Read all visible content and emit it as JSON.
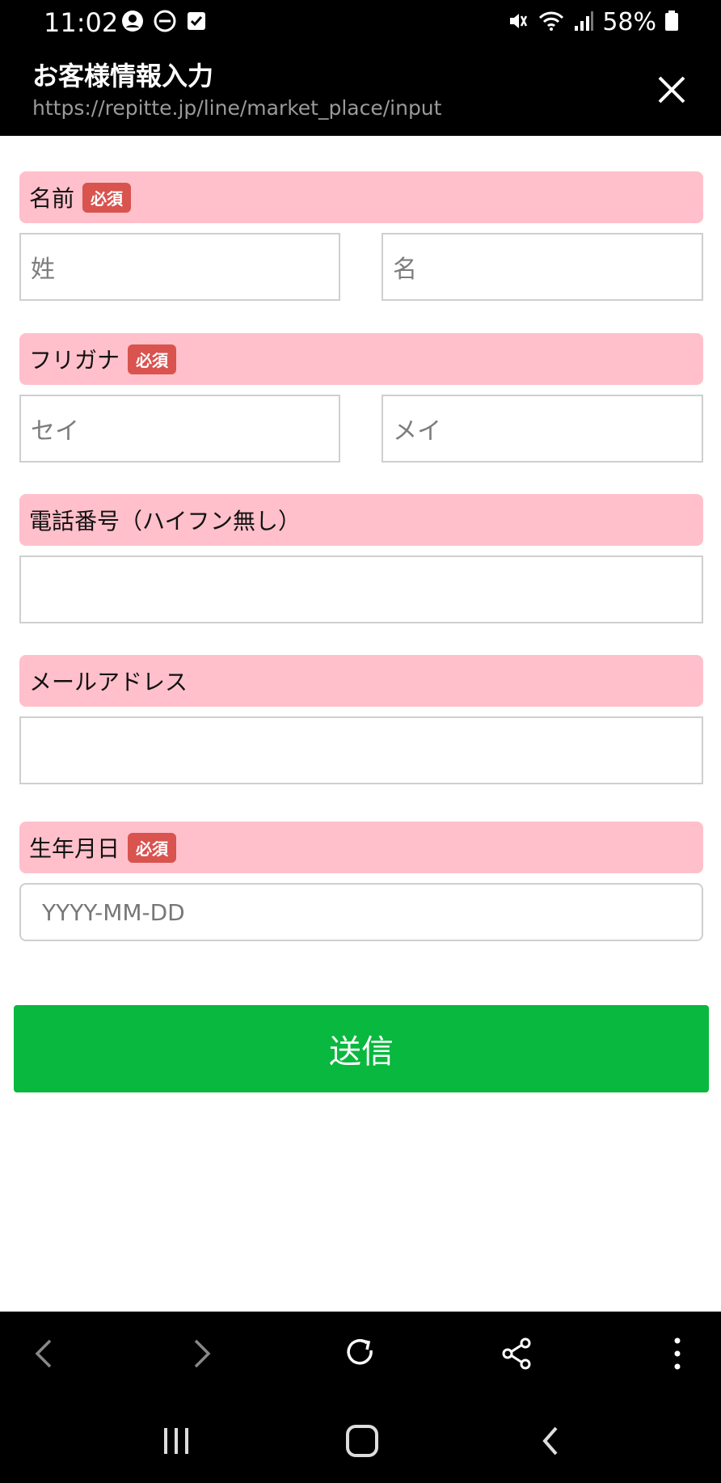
{
  "status_bar": {
    "time": "11:02",
    "battery_percent": "58%"
  },
  "app_bar": {
    "title": "お客様情報入力",
    "url": "https://repitte.jp/line/market_place/input"
  },
  "form": {
    "required_label": "必須",
    "sections": {
      "name": {
        "label": "名前",
        "required": true,
        "placeholders": [
          "姓",
          "名"
        ]
      },
      "furigana": {
        "label": "フリガナ",
        "required": true,
        "placeholders": [
          "セイ",
          "メイ"
        ]
      },
      "phone": {
        "label": "電話番号（ハイフン無し）",
        "required": false
      },
      "email": {
        "label": "メールアドレス",
        "required": false
      },
      "birthdate": {
        "label": "生年月日",
        "required": true,
        "placeholder": "YYYY-MM-DD"
      }
    },
    "submit_label": "送信"
  },
  "colors": {
    "header_pink": "#ffc0cb",
    "badge_red": "#d9534f",
    "submit_green": "#09b83e"
  },
  "icons": {
    "status_left": [
      "account-circle-icon",
      "do-not-disturb-icon",
      "checkbox-icon"
    ],
    "status_right": [
      "mute-icon",
      "wifi-icon",
      "signal-icon",
      "battery-icon"
    ],
    "toolbar": [
      "back-arrow-icon",
      "forward-arrow-icon",
      "reload-icon",
      "share-icon",
      "more-vertical-icon"
    ],
    "navbar": [
      "recent-apps-icon",
      "home-icon",
      "back-icon"
    ]
  }
}
